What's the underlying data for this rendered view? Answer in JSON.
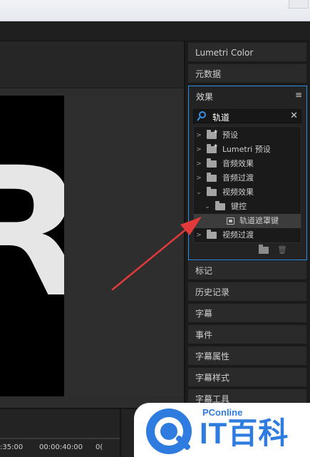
{
  "panels": {
    "top_tabs": [
      "Lumetri Color",
      "元数据"
    ],
    "bottom_tabs": [
      "标记",
      "历史记录",
      "字幕",
      "事件",
      "字幕属性",
      "字幕样式",
      "字幕工具"
    ]
  },
  "effects_panel": {
    "title": "效果",
    "menu_icon": "hamburger-icon",
    "search": {
      "value": "轨道",
      "icon": "search-icon",
      "clear_icon": "close-icon"
    },
    "tree": [
      {
        "label": "预设",
        "icon": "preset-folder-icon",
        "expanded": false
      },
      {
        "label": "Lumetri 预设",
        "icon": "preset-folder-icon",
        "expanded": false
      },
      {
        "label": "音频效果",
        "icon": "folder-icon",
        "expanded": false
      },
      {
        "label": "音频过渡",
        "icon": "folder-icon",
        "expanded": false
      },
      {
        "label": "视频效果",
        "icon": "folder-icon",
        "expanded": true
      },
      {
        "label": "键控",
        "icon": "folder-icon",
        "expanded": true
      },
      {
        "label": "轨道遮罩键",
        "icon": "effect-icon",
        "selected": true
      },
      {
        "label": "视频过渡",
        "icon": "folder-icon",
        "expanded": false
      }
    ],
    "footer_icons": [
      "new-bin-icon",
      "trash-icon"
    ]
  },
  "timeline": {
    "timecodes": [
      ":35:00",
      "00:00:40:00",
      "0("
    ]
  },
  "preview": {
    "letter": "R"
  },
  "watermark": {
    "small": "PConline",
    "big": "IT百科"
  },
  "colors": {
    "accent": "#2e8fe6",
    "arrow": "#e23a3a",
    "logo": "#2f7ce0"
  }
}
